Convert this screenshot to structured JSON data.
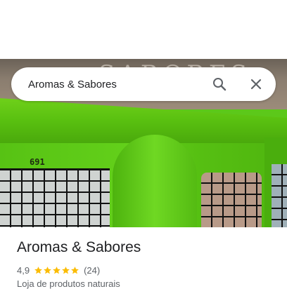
{
  "search": {
    "query": "Aromas & Sabores",
    "search_icon": "search-icon",
    "close_icon": "close-icon"
  },
  "photo": {
    "description_icon": "storefront-photo",
    "street_number": "691",
    "sign_text": "SABORES"
  },
  "place": {
    "name": "Aromas & Sabores",
    "rating": "4,9",
    "stars": 5,
    "review_count": "(24)",
    "category": "Loja de produtos naturais"
  },
  "colors": {
    "star": "#fbbc04",
    "text_primary": "#202124",
    "text_secondary": "#5f6368",
    "storefront_green": "#5cc81a"
  }
}
